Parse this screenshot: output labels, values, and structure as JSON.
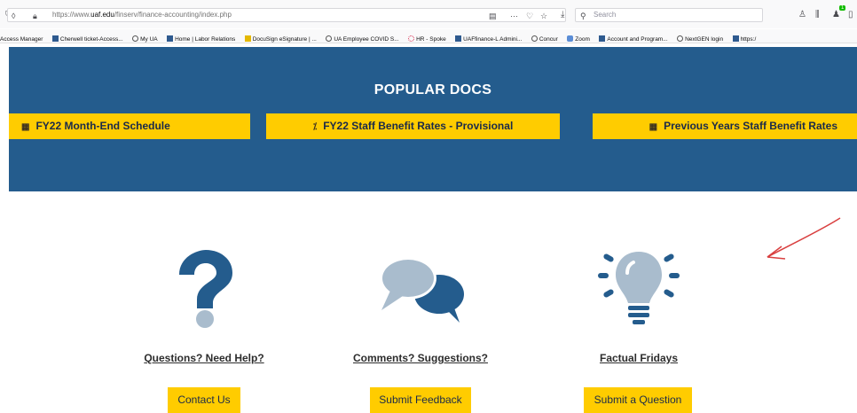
{
  "browser": {
    "url_prefix": "https://www.",
    "url_domain": "uaf.edu",
    "url_path": "/finserv/finance-accounting/index.php",
    "search_placeholder": "Search",
    "bookmarks": [
      {
        "label": "Access Manager",
        "icon": "square"
      },
      {
        "label": "Cherwell ticket-Access...",
        "icon": "square"
      },
      {
        "label": "My UA",
        "icon": "globe"
      },
      {
        "label": "Home | Labor Relations",
        "icon": "square"
      },
      {
        "label": "DocuSign eSignature | ...",
        "icon": "docusign"
      },
      {
        "label": "UA Employee COVID S...",
        "icon": "globe"
      },
      {
        "label": "HR - Spoke",
        "icon": "hubspot"
      },
      {
        "label": "UAFfinance-L Admini...",
        "icon": "square"
      },
      {
        "label": "Concur",
        "icon": "globe"
      },
      {
        "label": "Zoom",
        "icon": "zoom"
      },
      {
        "label": "Account and Program...",
        "icon": "square"
      },
      {
        "label": "NextGEN login",
        "icon": "globe"
      },
      {
        "label": "https:/",
        "icon": "square"
      }
    ],
    "extension_badge": "1"
  },
  "popular_docs": {
    "title": "POPULAR DOCS",
    "items": [
      {
        "label": "FY22 Month-End Schedule",
        "icon": "calendar-icon"
      },
      {
        "label": "FY22 Staff Benefit Rates - Provisional",
        "icon": "percent-icon"
      },
      {
        "label": "Previous Years Staff Benefit Rates",
        "icon": "calendar-icon"
      }
    ]
  },
  "features": [
    {
      "title": "Questions? Need Help?",
      "button": "Contact Us",
      "icon": "question-mark-icon"
    },
    {
      "title": "Comments? Suggestions?",
      "button": "Submit Feedback",
      "icon": "speech-bubbles-icon"
    },
    {
      "title": "Factual Fridays",
      "button": "Submit a Question",
      "icon": "lightbulb-icon"
    }
  ],
  "colors": {
    "band": "#245c8d",
    "accent": "#ffcc00",
    "icon_dark": "#245c8d",
    "icon_light": "#a9bccd",
    "annotation": "#d94040"
  }
}
